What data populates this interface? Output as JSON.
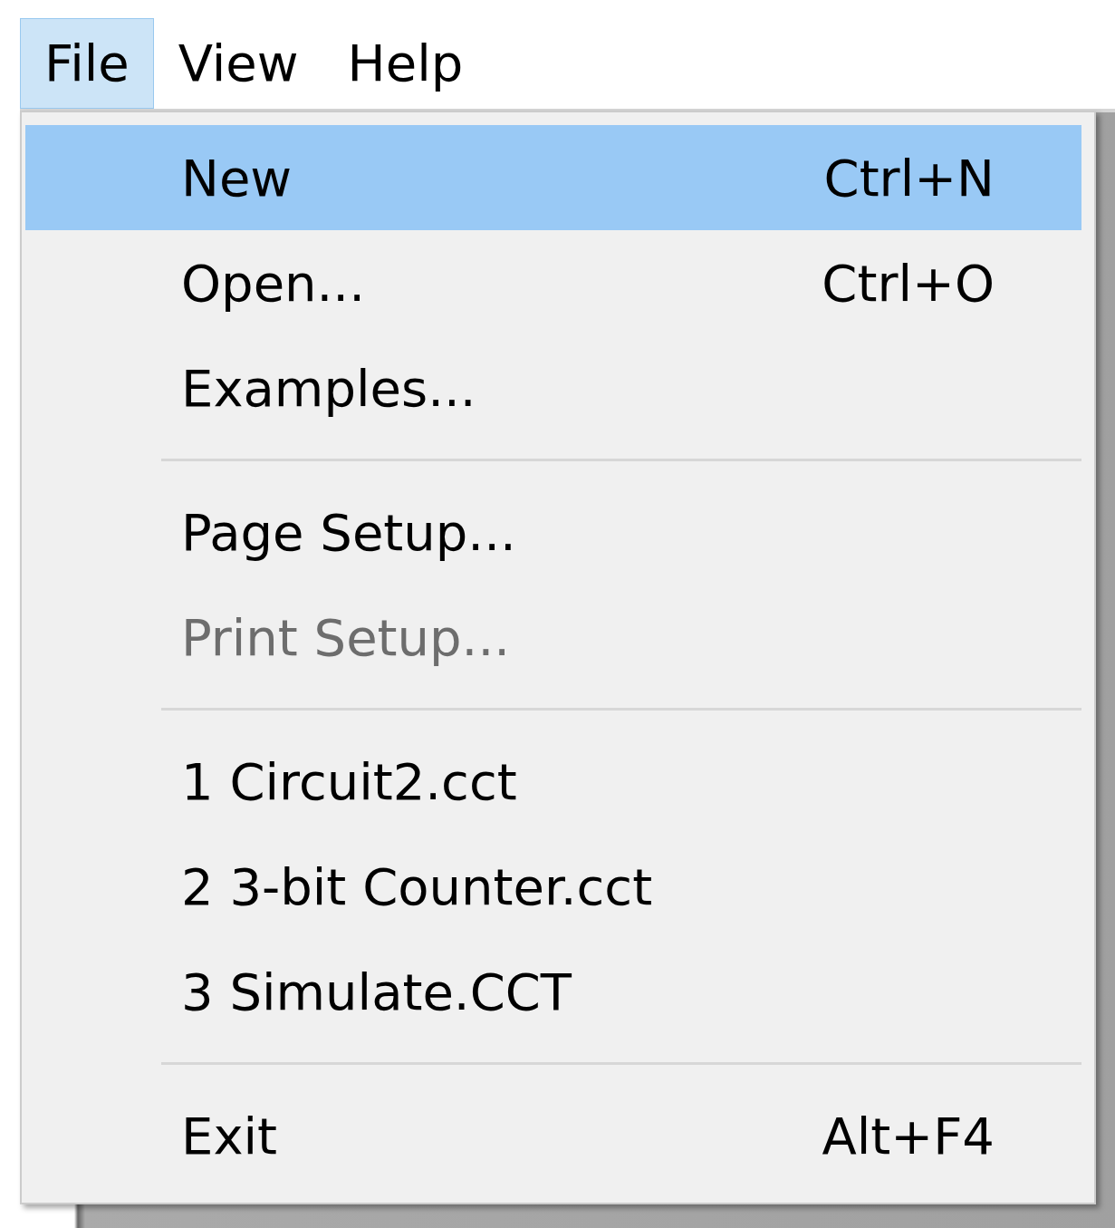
{
  "menubar": [
    {
      "label": "File",
      "selected": true
    },
    {
      "label": "View",
      "selected": false
    },
    {
      "label": "Help",
      "selected": false
    }
  ],
  "menu": {
    "items": [
      {
        "kind": "item",
        "label": "New",
        "shortcut": "Ctrl+N",
        "selected": true,
        "disabled": false
      },
      {
        "kind": "item",
        "label": "Open...",
        "shortcut": "Ctrl+O",
        "selected": false,
        "disabled": false
      },
      {
        "kind": "item",
        "label": "Examples...",
        "selected": false,
        "disabled": false
      },
      {
        "kind": "separator"
      },
      {
        "kind": "item",
        "label": "Page Setup...",
        "selected": false,
        "disabled": false
      },
      {
        "kind": "item",
        "label": "Print Setup...",
        "selected": false,
        "disabled": true
      },
      {
        "kind": "separator"
      },
      {
        "kind": "item",
        "label": "1 Circuit2.cct",
        "selected": false,
        "disabled": false
      },
      {
        "kind": "item",
        "label": "2 3-bit Counter.cct",
        "selected": false,
        "disabled": false
      },
      {
        "kind": "item",
        "label": "3 Simulate.CCT",
        "selected": false,
        "disabled": false
      },
      {
        "kind": "separator"
      },
      {
        "kind": "item",
        "label": "Exit",
        "shortcut": "Alt+F4",
        "selected": false,
        "disabled": false
      }
    ]
  }
}
